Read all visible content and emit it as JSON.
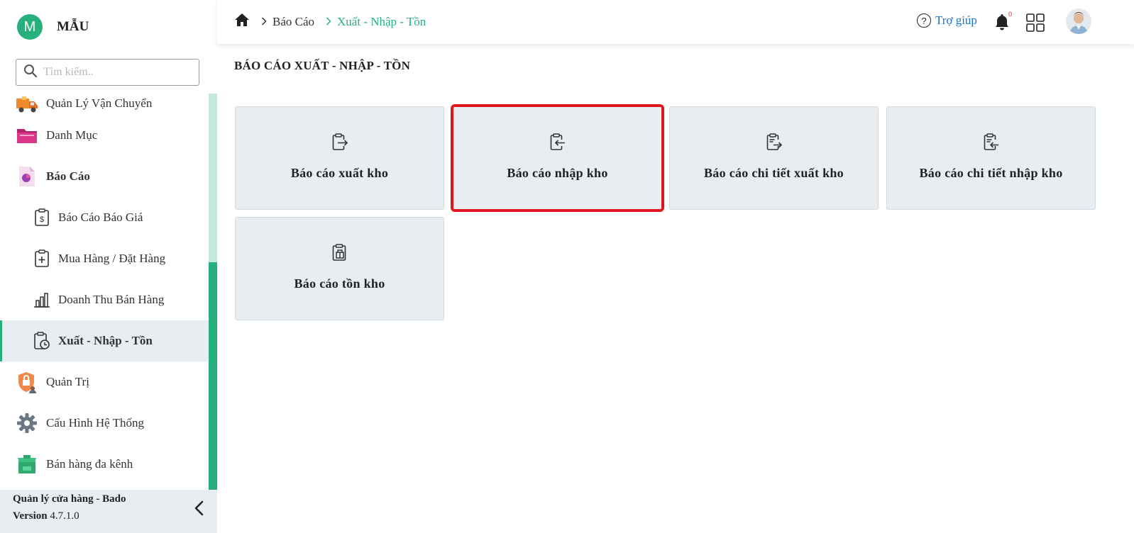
{
  "brand": {
    "initial": "M",
    "name": "MẪU"
  },
  "search": {
    "placeholder": "Tìm kiếm.."
  },
  "sidebar": {
    "items": [
      {
        "label": "Quản Lý Vận Chuyển",
        "icon": "truck-icon"
      },
      {
        "label": "Danh Mục",
        "icon": "folder-icon"
      },
      {
        "label": "Báo Cáo",
        "icon": "report-icon"
      },
      {
        "label": "Báo Cáo Báo Giá",
        "icon": "clipboard-dollar-icon"
      },
      {
        "label": "Mua Hàng / Đặt Hàng",
        "icon": "clipboard-plus-icon"
      },
      {
        "label": "Doanh Thu Bán Hàng",
        "icon": "bar-chart-icon"
      },
      {
        "label": "Xuất - Nhập - Tồn",
        "icon": "clipboard-clock-icon"
      },
      {
        "label": "Quản Trị",
        "icon": "shield-user-icon"
      },
      {
        "label": "Cấu Hình Hệ Thống",
        "icon": "gear-icon"
      },
      {
        "label": "Bán hàng đa kênh",
        "icon": "shop-icon"
      }
    ]
  },
  "footer": {
    "app_name": "Quản lý cửa hàng - Bado",
    "version_label": "Version",
    "version": "4.7.1.0"
  },
  "header": {
    "breadcrumb": [
      "Báo Cáo",
      "Xuất - Nhập - Tồn"
    ],
    "help_label": "Trợ giúp",
    "notification_count": "0"
  },
  "page": {
    "title": "BÁO CÁO XUẤT - NHẬP - TỒN",
    "cards": [
      {
        "label": "Báo cáo xuất kho"
      },
      {
        "label": "Báo cáo nhập kho"
      },
      {
        "label": "Báo cáo chi tiết xuất kho"
      },
      {
        "label": "Báo cáo chi tiết nhập kho"
      },
      {
        "label": "Báo cáo tồn kho"
      }
    ]
  },
  "colors": {
    "accent": "#27b07e",
    "link": "#1c73c9",
    "highlight": "#e0161e",
    "card_bg": "#e8edf1"
  }
}
